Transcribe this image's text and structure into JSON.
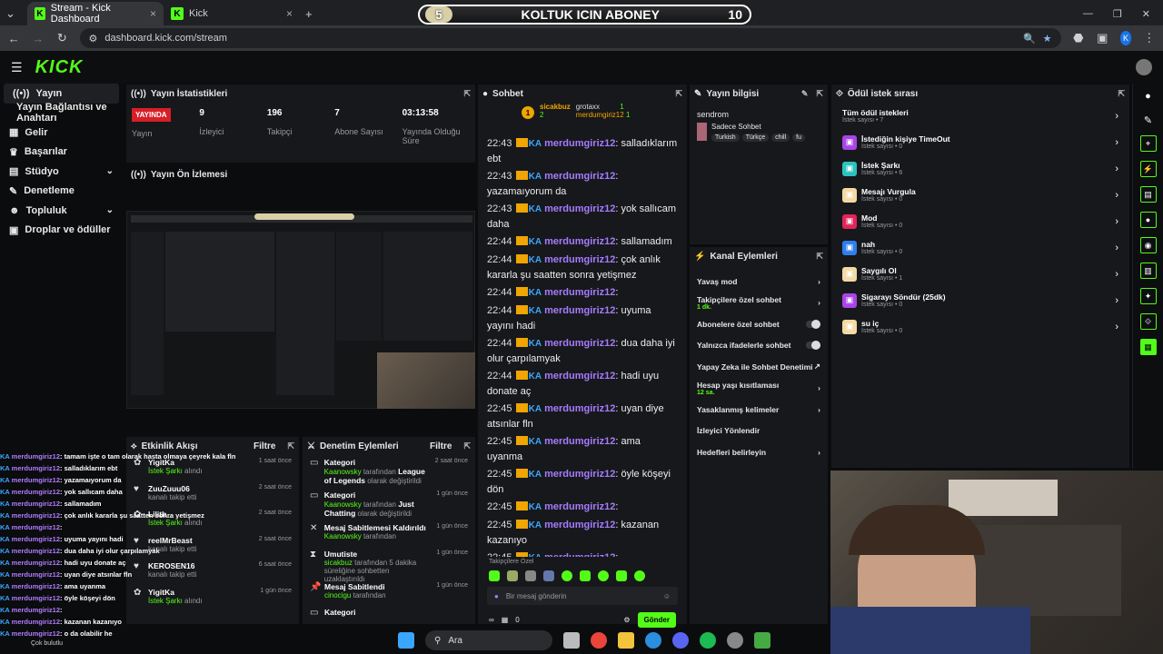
{
  "browser": {
    "tabs": [
      {
        "label": "Stream - Kick Dashboard",
        "active": true
      },
      {
        "label": "Kick",
        "active": false
      }
    ],
    "url": "dashboard.kick.com/stream",
    "profile_initial": "K"
  },
  "overlay": {
    "left": "5",
    "title": "KOLTUK ICIN ABONEY",
    "right": "10"
  },
  "kick": {
    "logo": "KICK"
  },
  "sidebar": {
    "items": [
      {
        "label": "Yayın",
        "icon": "live-icon",
        "active": true
      },
      {
        "label": "Yayın Bağlantısı ve Anahtarı",
        "icon": "",
        "active": false
      },
      {
        "label": "Gelir",
        "icon": "revenue-icon",
        "active": false
      },
      {
        "label": "Başarılar",
        "icon": "trophy-icon",
        "active": false
      },
      {
        "label": "Stüdyo",
        "icon": "studio-icon",
        "active": false,
        "chevron": true
      },
      {
        "label": "Denetleme",
        "icon": "moderation-icon",
        "active": false
      },
      {
        "label": "Topluluk",
        "icon": "community-icon",
        "active": false,
        "chevron": true
      },
      {
        "label": "Droplar ve ödüller",
        "icon": "gift-icon",
        "active": false
      }
    ]
  },
  "stats": {
    "title": "Yayın İstatistikleri",
    "live_badge": "YAYINDA",
    "live_label": "Yayın",
    "items": [
      {
        "value": "9",
        "label": "İzleyici"
      },
      {
        "value": "196",
        "label": "Takipçi"
      },
      {
        "value": "7",
        "label": "Abone Sayısı"
      },
      {
        "value": "03:13:58",
        "label": "Yayında Olduğu Süre"
      }
    ]
  },
  "preview": {
    "title": "Yayın Ön İzlemesi"
  },
  "activity": {
    "title": "Etkinlik Akışı",
    "filter": "Filtre",
    "items": [
      {
        "name": "YigitKa",
        "desc": "İstek Şarkı",
        "suffix": "alındı",
        "time": "1 saat önce"
      },
      {
        "name": "ZuuZuuu06",
        "desc": "kanalı takip etti",
        "suffix": "",
        "time": "2 saat önce"
      },
      {
        "name": "Lilith_",
        "desc": "İstek Şarkı",
        "suffix": "alındı",
        "time": "2 saat önce"
      },
      {
        "name": "reelMrBeast",
        "desc": "kanalı takip etti",
        "suffix": "",
        "time": "2 saat önce"
      },
      {
        "name": "KEROSEN16",
        "desc": "kanalı takip etti",
        "suffix": "",
        "time": "6 saat önce"
      },
      {
        "name": "YigitKa",
        "desc": "İstek Şarkı",
        "suffix": "alındı",
        "time": "1 gün önce"
      }
    ]
  },
  "moderation": {
    "title": "Denetim Eylemleri",
    "filter": "Filtre",
    "items": [
      {
        "title": "Kategori",
        "actor": "Kaanowsky",
        "mid": "tarafından",
        "target": "League of Legends",
        "tail": "olarak değiştirildi",
        "time": "2 saat önce"
      },
      {
        "title": "Kategori",
        "actor": "Kaanowsky",
        "mid": "tarafından",
        "target": "Just Chatting",
        "tail": "olarak değiştirildi",
        "time": "1 gün önce"
      },
      {
        "title": "Mesaj Sabitlemesi Kaldırıldı",
        "actor": "Kaanowsky",
        "mid": "tarafından",
        "target": "",
        "tail": "",
        "time": "1 gün önce"
      },
      {
        "title": "Umutiste",
        "actor": "sicakbuz",
        "mid": "tarafından 5 dakika süreliğine sohbetten uzaklaştırıldı",
        "target": "",
        "tail": "",
        "time": "1 gün önce"
      },
      {
        "title": "Mesaj Sabitlendi",
        "actor": "cinocigu",
        "mid": "tarafından",
        "target": "",
        "tail": "",
        "time": "1 gün önce"
      },
      {
        "title": "Kategori",
        "actor": "",
        "mid": "",
        "target": "",
        "tail": "",
        "time": ""
      }
    ]
  },
  "chat": {
    "title": "Sohbet",
    "top": {
      "first": "sicakbuz",
      "first_n": "2",
      "second": "grotaxx",
      "second_n": "1",
      "third": "merdumgiriz12",
      "third_n": "1",
      "rank": "1"
    },
    "user": "merdumgiriz12",
    "badge": "KA",
    "messages": [
      {
        "time": "22:43",
        "text": "salladıklarım ebt"
      },
      {
        "time": "22:43",
        "text": "yazamaıyorum da"
      },
      {
        "time": "22:43",
        "text": "yok sallıcam daha"
      },
      {
        "time": "22:44",
        "text": "sallamadım"
      },
      {
        "time": "22:44",
        "text": "çok anlık kararla şu saatten sonra yetişmez"
      },
      {
        "time": "22:44",
        "text": ""
      },
      {
        "time": "22:44",
        "text": "uyuma yayını hadi"
      },
      {
        "time": "22:44",
        "text": "dua daha iyi olur çarpılamyak"
      },
      {
        "time": "22:44",
        "text": "hadi uyu donate aç"
      },
      {
        "time": "22:45",
        "text": "uyan diye atsınlar fln"
      },
      {
        "time": "22:45",
        "text": "ama uyanma"
      },
      {
        "time": "22:45",
        "text": "öyle köşeyi dön"
      },
      {
        "time": "22:45",
        "text": ""
      },
      {
        "time": "22:45",
        "text": "kazanan kazanıyo"
      },
      {
        "time": "22:45",
        "text": ""
      },
      {
        "time": "22:45",
        "text": "o da olabilir he"
      }
    ],
    "followers_only": "Takipçilere Özel",
    "placeholder": "Bir mesaj gönderin",
    "send": "Gönder",
    "counter": "0"
  },
  "info": {
    "title": "Yayın bilgisi",
    "stream_title": "sendrom",
    "category": "Sadece Sohbet",
    "tags": [
      "Turkish",
      "Türkçe",
      "chill",
      "fu"
    ]
  },
  "actions": {
    "title": "Kanal Eylemleri",
    "items": [
      {
        "label": "Yavaş mod",
        "sub": "",
        "control": "arrow"
      },
      {
        "label": "Takipçilere özel sohbet",
        "sub": "1 dk.",
        "control": "arrow"
      },
      {
        "label": "Abonelere özel sohbet",
        "sub": "",
        "control": "toggle"
      },
      {
        "label": "Yalnızca ifadelerle sohbet",
        "sub": "",
        "control": "toggle"
      },
      {
        "label": "Yapay Zeka ile Sohbet Denetimi",
        "sub": "",
        "control": "link"
      },
      {
        "label": "Hesap yaşı kısıtlaması",
        "sub": "12 sa.",
        "control": "arrow"
      },
      {
        "label": "Yasaklanmış kelimeler",
        "sub": "",
        "control": "arrow"
      },
      {
        "label": "İzleyici Yönlendir",
        "sub": "",
        "control": ""
      },
      {
        "label": "Hedefleri belirleyin",
        "sub": "",
        "control": "arrow"
      }
    ]
  },
  "rewards": {
    "title": "Ödül istek sırası",
    "all": {
      "label": "Tüm ödül istekleri",
      "sub": "İstek sayısı • 7"
    },
    "items": [
      {
        "label": "İstediğin kişiye TimeOut",
        "sub": "İstek sayısı • 0",
        "color": "#a945e8"
      },
      {
        "label": "İstek Şarkı",
        "sub": "İstek sayısı • 6",
        "color": "#29c3c0"
      },
      {
        "label": "Mesajı Vurgula",
        "sub": "İstek sayısı • 0",
        "color": "#f5d9a3"
      },
      {
        "label": "Mod",
        "sub": "İstek sayısı • 0",
        "color": "#e2245a"
      },
      {
        "label": "nah",
        "sub": "İstek sayısı • 0",
        "color": "#2f7ef0"
      },
      {
        "label": "Saygılı Ol",
        "sub": "İstek sayısı • 1",
        "color": "#f5d9a3"
      },
      {
        "label": "Sigarayı Söndür (25dk)",
        "sub": "İstek sayısı • 0",
        "color": "#a945e8"
      },
      {
        "label": "su iç",
        "sub": "İstek sayısı • 0",
        "color": "#f5d9a3"
      }
    ]
  },
  "overlay_chat": {
    "badge": "KA",
    "user": "merdumgiriz12",
    "lines": [
      ": tamam işte o tam olarak hasta olmaya çeyrek kala fln",
      ": salladıklarım ebt",
      ": yazamaıyorum da",
      ": yok sallıcam daha",
      ": sallamadım",
      ": çok anlık kararla şu saatten sonra yetişmez",
      ":",
      ": uyuma yayını hadi",
      ": dua daha iyi olur çarpılamyak",
      ": hadi uyu donate aç",
      ": uyan diye atsınlar fln",
      ": ama uyanma",
      ": öyle köşeyi dön",
      ":",
      ": kazanan kazanıyo",
      ": o da olabilir he"
    ],
    "corner": "Çok bulutlu"
  },
  "taskbar": {
    "search": "Ara"
  }
}
